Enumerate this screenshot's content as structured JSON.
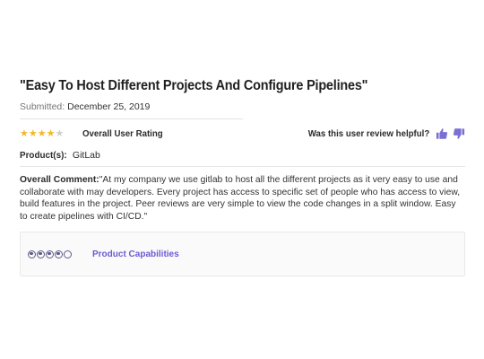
{
  "review": {
    "title": "\"Easy To Host Different Projects And Configure Pipelines\"",
    "submitted_label": "Submitted:",
    "submitted_date": "December 25, 2019",
    "rating": {
      "value": 4,
      "max": 5
    },
    "overall_rating_label": "Overall User Rating",
    "helpful_question": "Was this user review helpful?",
    "product_label": "Product(s):",
    "product_value": "GitLab",
    "comment_label": "Overall Comment:",
    "comment_text": "\"At my company we use gitlab to host all the different projects as it very easy to use and collaborate with may developers. Every project has access to specific set of people who has access to view, build features in the project. Peer reviews are very simple to view the code changes in a split window. Easy to create pipelines with CI/CD.\""
  },
  "capabilities": {
    "label": "Product Capabilities",
    "score": 4,
    "max": 5
  },
  "colors": {
    "star": "#f1b82d",
    "thumb": "#7b6fd3",
    "accent": "#6b5bd1"
  },
  "icons": {
    "thumbs_up": "thumbs-up-icon",
    "thumbs_down": "thumbs-down-icon",
    "star": "star-icon"
  }
}
